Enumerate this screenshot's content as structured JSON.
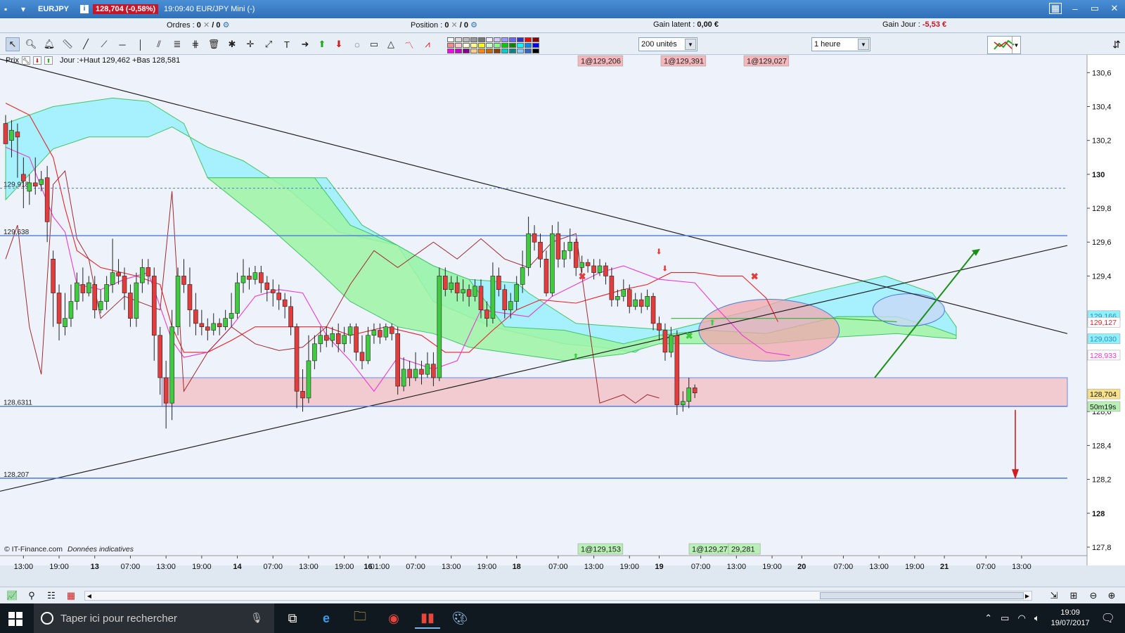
{
  "title_bar": {
    "symbol": "EURJPY",
    "info_icon": "info-icon",
    "price_badge": "128,704 (-0,58%)",
    "window_title": "19:09:40 EUR/JPY Mini (-)"
  },
  "status_bar": {
    "orders_label": "Ordres :",
    "orders_value": "0",
    "orders_sep": "/ 0",
    "position_label": "Position :",
    "position_value": "0",
    "position_sep": "/ 0",
    "gain_latent_label": "Gain latent :",
    "gain_latent_value": "0,00 €",
    "gain_jour_label": "Gain Jour :",
    "gain_jour_value": "-5,53 €"
  },
  "toolbar": {
    "units_select": "200 unités",
    "period_select": "1 heure"
  },
  "indicator_header": {
    "prix_label": "Prix",
    "jour_text": "Jour :+Haut 129,462 +Bas 128,581"
  },
  "colors": {
    "up": "#3fca3f",
    "down": "#e23c3c",
    "cloud_green": "#9ef5a3",
    "cloud_cyan": "#8ff0ff",
    "line_red": "#e3242b",
    "line_magenta": "#e83ad6",
    "line_brown": "#a02a30",
    "level_blue": "#4a7ae0",
    "zone_pink": "#f2c4c8",
    "badge_red": "#f4b7bb",
    "badge_green": "#b9f0b6"
  },
  "order_badges_top": [
    "1@129,206",
    "1@129,391",
    "1@129,027"
  ],
  "order_badges_bottom": [
    "1@129,153",
    "1@129,277",
    "29,281"
  ],
  "level_labels": [
    {
      "text": "129,918",
      "price": 129.918
    },
    {
      "text": "129,638",
      "price": 129.638
    },
    {
      "text": "128,6311",
      "price": 128.631
    },
    {
      "text": "128,207",
      "price": 128.207
    }
  ],
  "price_axis": {
    "ticks": [
      {
        "label": "130,6",
        "v": 130.6
      },
      {
        "label": "130,4",
        "v": 130.4
      },
      {
        "label": "130,2",
        "v": 130.2
      },
      {
        "label": "130",
        "v": 130.0,
        "bold": true
      },
      {
        "label": "129,8",
        "v": 129.8
      },
      {
        "label": "129,6",
        "v": 129.6
      },
      {
        "label": "129,4",
        "v": 129.4
      },
      {
        "label": "128,6",
        "v": 128.6
      },
      {
        "label": "128,4",
        "v": 128.4
      },
      {
        "label": "128,2",
        "v": 128.2
      },
      {
        "label": "128",
        "v": 128.0,
        "bold": true
      },
      {
        "label": "127,8",
        "v": 127.8
      }
    ],
    "value_badges": [
      {
        "text": "129,166",
        "v": 129.166,
        "color": "#8ff0ff",
        "tc": "#2a8fb0"
      },
      {
        "text": "129,127",
        "v": 129.127,
        "color": "#ffffff",
        "tc": "#e3242b"
      },
      {
        "text": "129,030",
        "v": 129.03,
        "color": "#8ff0ff",
        "tc": "#2a8fb0"
      },
      {
        "text": "128,933",
        "v": 128.933,
        "color": "#ffffff",
        "tc": "#e83ad6"
      },
      {
        "text": "128,704",
        "v": 128.704,
        "color": "#f7e08a",
        "tc": "#111111"
      },
      {
        "text": "50m19s",
        "v": 128.63,
        "color": "#b9f0b6",
        "tc": "#111111"
      }
    ]
  },
  "time_axis": {
    "labels": [
      {
        "text": "13:00",
        "i": 3
      },
      {
        "text": "19:00",
        "i": 9
      },
      {
        "text": "13",
        "i": 15,
        "bold": true
      },
      {
        "text": "07:00",
        "i": 21
      },
      {
        "text": "13:00",
        "i": 27
      },
      {
        "text": "19:00",
        "i": 33
      },
      {
        "text": "14",
        "i": 39,
        "bold": true
      },
      {
        "text": "07:00",
        "i": 45
      },
      {
        "text": "13:00",
        "i": 51
      },
      {
        "text": "19:00",
        "i": 57
      },
      {
        "text": "16",
        "i": 61,
        "bold": true
      },
      {
        "text": "01:00",
        "i": 63
      },
      {
        "text": "07:00",
        "i": 69
      },
      {
        "text": "13:00",
        "i": 75
      },
      {
        "text": "19:00",
        "i": 81
      },
      {
        "text": "18",
        "i": 86,
        "bold": true
      },
      {
        "text": "07:00",
        "i": 93
      },
      {
        "text": "13:00",
        "i": 99
      },
      {
        "text": "19:00",
        "i": 105
      },
      {
        "text": "19",
        "i": 110,
        "bold": true
      },
      {
        "text": "07:00",
        "i": 117
      },
      {
        "text": "13:00",
        "i": 123
      },
      {
        "text": "19:00",
        "i": 129
      },
      {
        "text": "20",
        "i": 134,
        "bold": true
      },
      {
        "text": "07:00",
        "i": 141
      },
      {
        "text": "13:00",
        "i": 147
      },
      {
        "text": "19:00",
        "i": 153
      },
      {
        "text": "21",
        "i": 158,
        "bold": true
      },
      {
        "text": "07:00",
        "i": 165
      },
      {
        "text": "13:00",
        "i": 171
      }
    ]
  },
  "chart_data": {
    "type": "candlestick",
    "x_axis": "time (1 heure)",
    "y_range": [
      127.75,
      130.68
    ],
    "candles": [
      [
        130.3,
        130.18,
        130.35,
        130.2
      ],
      [
        130.2,
        130.26,
        130.32,
        130.1
      ],
      [
        130.25,
        130.22,
        130.3,
        129.98
      ],
      [
        130.0,
        129.96,
        130.1,
        129.8
      ],
      [
        129.9,
        129.95,
        130.0,
        129.82
      ],
      [
        129.95,
        129.93,
        130.1,
        129.88
      ],
      [
        129.94,
        129.97,
        130.02,
        129.9
      ],
      [
        129.98,
        129.72,
        130.05,
        129.6
      ],
      [
        129.5,
        129.3,
        129.55,
        129.1
      ],
      [
        129.3,
        129.12,
        129.35,
        129.02
      ],
      [
        129.1,
        129.15,
        129.3,
        129.05
      ],
      [
        129.15,
        129.25,
        129.35,
        129.1
      ],
      [
        129.25,
        129.36,
        129.42,
        129.2
      ],
      [
        129.35,
        129.3,
        129.45,
        129.25
      ],
      [
        129.3,
        129.36,
        129.4,
        129.28
      ],
      [
        129.35,
        129.2,
        129.4,
        129.15
      ],
      [
        129.2,
        129.25,
        129.32,
        129.18
      ],
      [
        129.25,
        129.35,
        129.4,
        129.2
      ],
      [
        129.35,
        129.42,
        129.62,
        129.3
      ],
      [
        129.42,
        129.4,
        129.5,
        129.35
      ],
      [
        129.4,
        129.3,
        129.45,
        129.2
      ],
      [
        129.3,
        129.15,
        129.35,
        129.1
      ],
      [
        129.15,
        129.36,
        129.42,
        129.1
      ],
      [
        129.36,
        129.45,
        129.5,
        129.3
      ],
      [
        129.45,
        129.4,
        129.5,
        129.35
      ],
      [
        129.4,
        129.05,
        129.45,
        128.9
      ],
      [
        129.05,
        128.8,
        129.1,
        128.7
      ],
      [
        128.8,
        128.65,
        128.9,
        128.5
      ],
      [
        128.65,
        129.1,
        129.2,
        128.55
      ],
      [
        129.1,
        129.4,
        129.45,
        129.05
      ],
      [
        129.4,
        129.35,
        129.5,
        129.3
      ],
      [
        129.35,
        129.2,
        129.45,
        129.1
      ],
      [
        129.2,
        129.12,
        129.3,
        129.05
      ],
      [
        129.12,
        129.1,
        129.2,
        129.05
      ],
      [
        129.1,
        129.08,
        129.15,
        129.02
      ],
      [
        129.08,
        129.12,
        129.18,
        129.05
      ],
      [
        129.12,
        129.1,
        129.15,
        129.05
      ],
      [
        129.1,
        129.15,
        129.2,
        129.08
      ],
      [
        129.15,
        129.18,
        129.3,
        129.1
      ],
      [
        129.18,
        129.36,
        129.42,
        129.15
      ],
      [
        129.36,
        129.4,
        129.5,
        129.3
      ],
      [
        129.4,
        129.38,
        129.45,
        129.32
      ],
      [
        129.38,
        129.42,
        129.46,
        129.35
      ],
      [
        129.42,
        129.36,
        129.46,
        129.3
      ],
      [
        129.36,
        129.32,
        129.4,
        129.25
      ],
      [
        129.32,
        129.3,
        129.38,
        129.22
      ],
      [
        129.3,
        129.26,
        129.35,
        129.2
      ],
      [
        129.26,
        129.22,
        129.3,
        129.15
      ],
      [
        129.22,
        129.1,
        129.28,
        129.05
      ],
      [
        129.1,
        128.72,
        129.12,
        128.62
      ],
      [
        128.72,
        128.68,
        128.85,
        128.6
      ],
      [
        128.68,
        128.9,
        129.05,
        128.65
      ],
      [
        128.9,
        129.0,
        129.05,
        128.85
      ],
      [
        129.0,
        129.05,
        129.1,
        128.95
      ],
      [
        129.05,
        129.02,
        129.1,
        128.98
      ],
      [
        129.02,
        129.06,
        129.1,
        128.98
      ],
      [
        129.06,
        129.0,
        129.12,
        128.95
      ],
      [
        129.0,
        129.05,
        129.1,
        128.95
      ],
      [
        129.05,
        129.1,
        129.12,
        129.0
      ],
      [
        129.1,
        128.95,
        129.12,
        128.9
      ],
      [
        128.95,
        128.9,
        129.05,
        128.85
      ],
      [
        128.9,
        129.05,
        129.1,
        128.88
      ],
      [
        129.05,
        129.08,
        129.12,
        129.0
      ],
      [
        129.08,
        129.04,
        129.12,
        129.0
      ],
      [
        129.04,
        129.1,
        129.12,
        129.02
      ],
      [
        129.1,
        129.06,
        129.12,
        129.02
      ],
      [
        129.06,
        128.75,
        129.1,
        128.7
      ],
      [
        128.75,
        128.85,
        128.92,
        128.72
      ],
      [
        128.85,
        128.8,
        128.9,
        128.75
      ],
      [
        128.8,
        128.85,
        128.95,
        128.78
      ],
      [
        128.85,
        128.82,
        128.9,
        128.76
      ],
      [
        128.82,
        128.88,
        128.95,
        128.8
      ],
      [
        128.88,
        128.8,
        128.95,
        128.75
      ],
      [
        128.8,
        129.4,
        129.45,
        128.78
      ],
      [
        129.4,
        129.32,
        129.45,
        129.28
      ],
      [
        129.32,
        129.36,
        129.4,
        129.3
      ],
      [
        129.36,
        129.3,
        129.4,
        129.25
      ],
      [
        129.3,
        129.32,
        129.38,
        129.25
      ],
      [
        129.32,
        129.28,
        129.35,
        129.22
      ],
      [
        129.28,
        129.34,
        129.38,
        129.25
      ],
      [
        129.34,
        129.2,
        129.38,
        129.15
      ],
      [
        129.2,
        129.15,
        129.25,
        129.1
      ],
      [
        129.15,
        129.4,
        129.48,
        129.12
      ],
      [
        129.4,
        129.32,
        129.45,
        129.28
      ],
      [
        129.32,
        129.2,
        129.35,
        129.15
      ],
      [
        129.2,
        129.25,
        129.3,
        129.15
      ],
      [
        129.25,
        129.35,
        129.4,
        129.2
      ],
      [
        129.35,
        129.45,
        129.55,
        129.3
      ],
      [
        129.45,
        129.65,
        129.75,
        129.4
      ],
      [
        129.65,
        129.6,
        129.7,
        129.55
      ],
      [
        129.6,
        129.5,
        129.65,
        129.45
      ],
      [
        129.5,
        129.3,
        129.55,
        129.28
      ],
      [
        129.3,
        129.65,
        129.7,
        129.28
      ],
      [
        129.65,
        129.5,
        129.72,
        129.45
      ],
      [
        129.5,
        129.55,
        129.6,
        129.45
      ],
      [
        129.55,
        129.6,
        129.68,
        129.5
      ],
      [
        129.6,
        129.45,
        129.62,
        129.4
      ],
      [
        129.45,
        129.48,
        129.52,
        129.42
      ],
      [
        129.48,
        129.46,
        129.5,
        129.42
      ],
      [
        129.46,
        129.42,
        129.5,
        129.38
      ],
      [
        129.42,
        129.46,
        129.5,
        129.4
      ],
      [
        129.46,
        129.4,
        129.48,
        129.35
      ],
      [
        129.4,
        129.26,
        129.45,
        129.22
      ],
      [
        129.26,
        129.28,
        129.32,
        129.22
      ],
      [
        129.28,
        129.32,
        129.38,
        129.25
      ],
      [
        129.32,
        129.22,
        129.35,
        129.18
      ],
      [
        129.22,
        129.26,
        129.3,
        129.2
      ],
      [
        129.26,
        129.22,
        129.3,
        129.18
      ],
      [
        129.22,
        129.28,
        129.32,
        129.2
      ],
      [
        129.28,
        129.12,
        129.3,
        129.08
      ],
      [
        129.12,
        129.08,
        129.16,
        129.02
      ],
      [
        129.08,
        128.95,
        129.12,
        128.9
      ],
      [
        128.95,
        129.05,
        129.1,
        128.92
      ],
      [
        129.05,
        128.64,
        129.08,
        128.58
      ],
      [
        128.64,
        128.66,
        128.72,
        128.6
      ],
      [
        128.66,
        128.74,
        128.8,
        128.62
      ],
      [
        128.74,
        128.71,
        128.76,
        128.68
      ]
    ]
  }
}
